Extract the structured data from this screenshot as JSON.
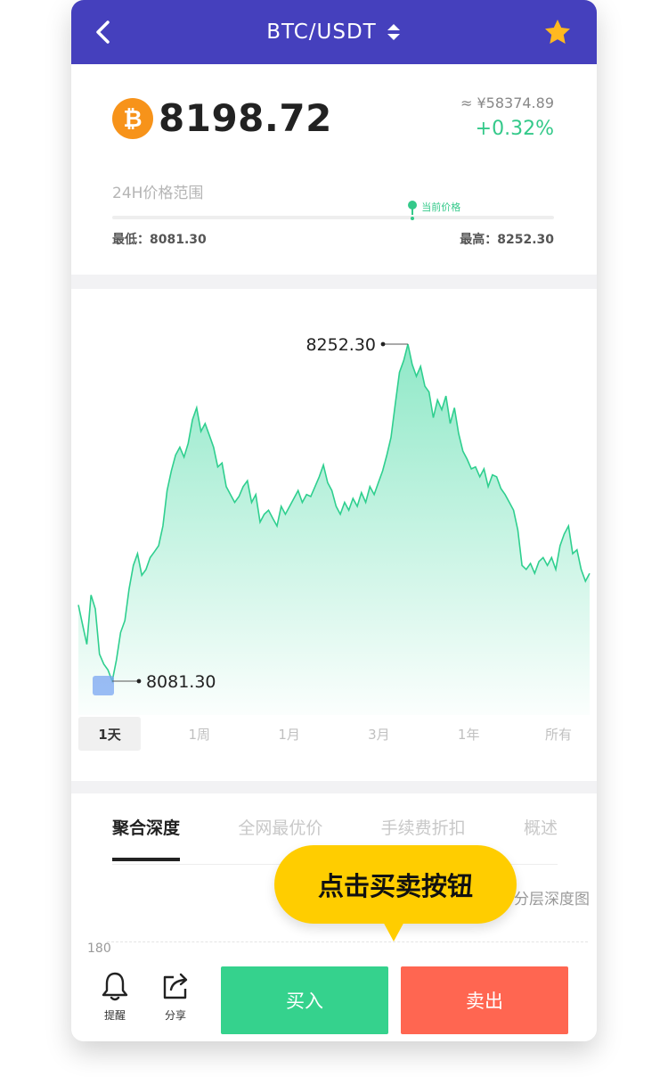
{
  "header": {
    "title": "BTC/USDT",
    "back_icon": "chevron-left-icon",
    "sort_icon": "sort-updown-icon",
    "favorite_icon": "star-icon",
    "bar_color": "#4540bd",
    "star_color": "#ffb820"
  },
  "price": {
    "coin_symbol": "₿",
    "current": "8198.72",
    "cny": "≈ ¥58374.89",
    "change": "+0.32%",
    "change_color": "#34c98a"
  },
  "range": {
    "label": "24H价格范围",
    "current_label": "当前价格",
    "current_position": 0.68,
    "low": "最低：8081.30",
    "high": "最高：8252.30"
  },
  "chart_data": {
    "type": "area",
    "y_min_label": "8081.30",
    "y_max_label": "8252.30",
    "color": "#34d69a",
    "values": [
      8120,
      8110,
      8100,
      8125,
      8118,
      8095,
      8090,
      8087,
      8081.3,
      8092,
      8106,
      8112,
      8128,
      8140,
      8146,
      8135,
      8138,
      8144,
      8147,
      8150,
      8160,
      8178,
      8188,
      8196,
      8200,
      8195,
      8202,
      8214,
      8220,
      8208,
      8212,
      8206,
      8200,
      8190,
      8192,
      8180,
      8176,
      8172,
      8175,
      8180,
      8183,
      8172,
      8176,
      8162,
      8166,
      8168,
      8164,
      8160,
      8170,
      8166,
      8170,
      8174,
      8178,
      8172,
      8176,
      8175,
      8180,
      8185,
      8191,
      8182,
      8178,
      8170,
      8166,
      8172,
      8168,
      8174,
      8170,
      8177,
      8172,
      8180,
      8176,
      8182,
      8188,
      8196,
      8205,
      8222,
      8238,
      8244,
      8252.3,
      8242,
      8236,
      8241,
      8231,
      8228,
      8215,
      8224,
      8219,
      8226,
      8212,
      8220,
      8207,
      8198,
      8194,
      8189,
      8190,
      8185,
      8189,
      8180,
      8186,
      8185,
      8179,
      8176,
      8172,
      8168,
      8158,
      8140,
      8138,
      8141,
      8136,
      8142,
      8144,
      8140,
      8144,
      8138,
      8150,
      8156,
      8160,
      8146,
      8148,
      8138,
      8132,
      8136
    ],
    "period_tabs": [
      "1天",
      "1周",
      "1月",
      "3月",
      "1年",
      "所有"
    ],
    "active_period": "1天"
  },
  "depth": {
    "tabs": [
      "聚合深度",
      "全网最优价",
      "手续费折扣",
      "概述"
    ],
    "active_tab": "聚合深度",
    "layer_link": "分层深度图",
    "axis_top": "180"
  },
  "bottom": {
    "remind": "提醒",
    "remind_icon": "bell-icon",
    "share": "分享",
    "share_icon": "share-icon",
    "buy": "买入",
    "sell": "卖出",
    "buy_color": "#35d28d",
    "sell_color": "#ff6651"
  },
  "tooltip": {
    "text": "点击买卖按钮",
    "color": "#ffcd00"
  }
}
